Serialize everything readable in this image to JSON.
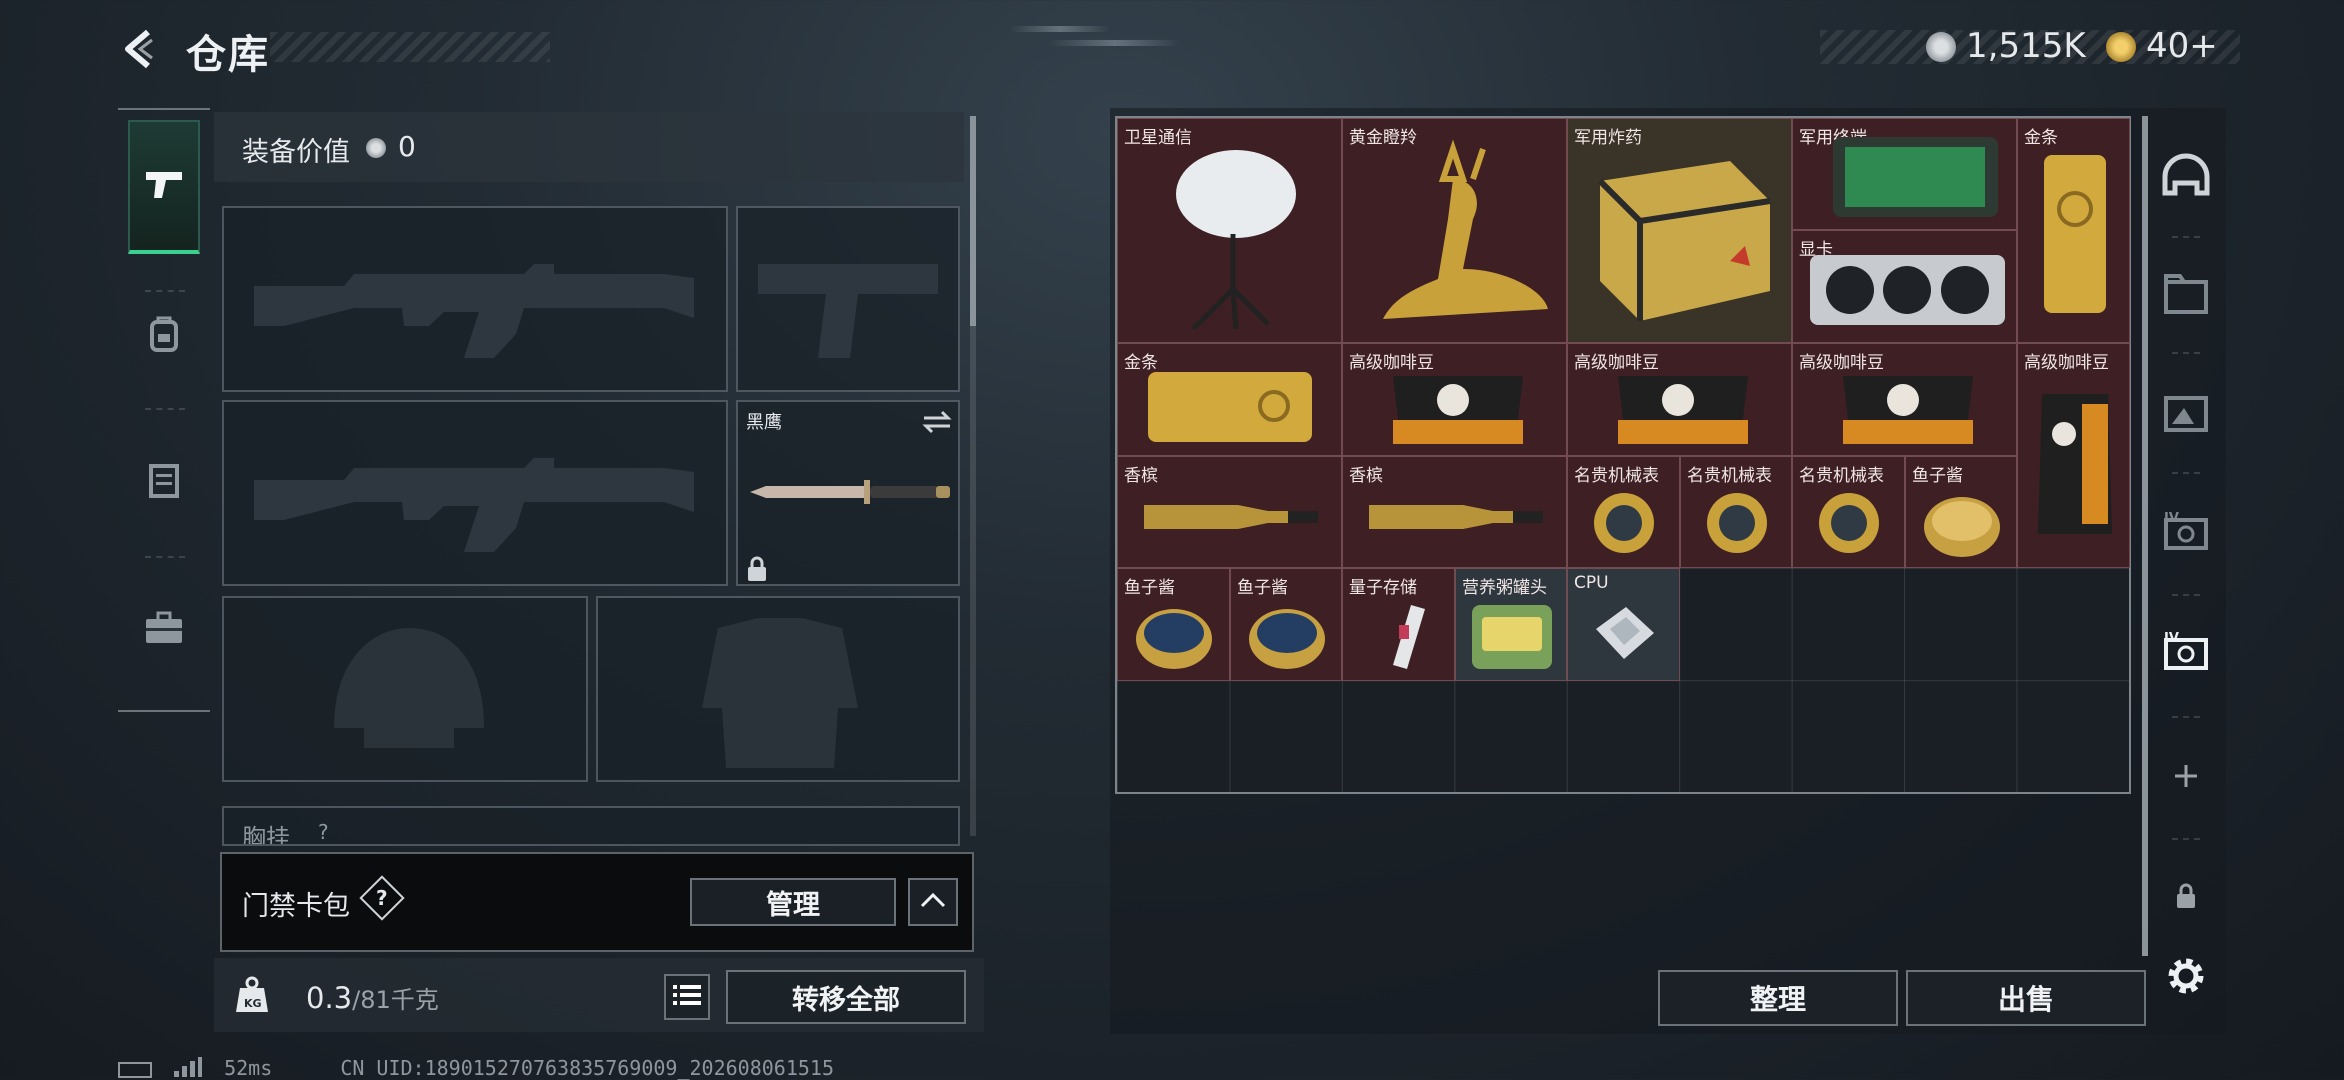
{
  "header": {
    "title": "仓库",
    "currency": [
      {
        "icon": "silver-coin-icon",
        "value": "1,515K"
      },
      {
        "icon": "gold-coin-icon",
        "value": "40+"
      }
    ]
  },
  "left_rail": [
    "pistol-icon",
    "backpack-icon",
    "vest-icon",
    "briefcase-icon"
  ],
  "loadout": {
    "value_label": "装备价值",
    "value": "0",
    "melee_name": "黑鹰",
    "next_label": "胸挂",
    "next_hint": "?"
  },
  "cardpack": {
    "label": "门禁卡包",
    "help": "?",
    "manage": "管理"
  },
  "weight": {
    "current": "0.3",
    "sep": "/",
    "max": "81千克"
  },
  "transfer_all": "转移全部",
  "items": [
    {
      "name": "卫星通信",
      "icon": "satellite-dish-icon"
    },
    {
      "name": "黄金瞪羚",
      "icon": "golden-gazelle-icon"
    },
    {
      "name": "军用炸药",
      "icon": "explosive-crate-icon"
    },
    {
      "name": "军用终端",
      "icon": "military-terminal-icon"
    },
    {
      "name": "金条",
      "icon": "gold-bar-icon"
    },
    {
      "name": "显卡",
      "icon": "graphics-card-icon"
    },
    {
      "name": "金条",
      "icon": "gold-bar-icon"
    },
    {
      "name": "高级咖啡豆",
      "icon": "coffee-bag-icon"
    },
    {
      "name": "高级咖啡豆",
      "icon": "coffee-bag-icon"
    },
    {
      "name": "高级咖啡豆",
      "icon": "coffee-bag-icon"
    },
    {
      "name": "高级咖啡豆",
      "icon": "coffee-bag-icon"
    },
    {
      "name": "香槟",
      "icon": "champagne-icon"
    },
    {
      "name": "香槟",
      "icon": "champagne-icon"
    },
    {
      "name": "名贵机械表",
      "icon": "watch-icon"
    },
    {
      "name": "名贵机械表",
      "icon": "watch-icon"
    },
    {
      "name": "名贵机械表",
      "icon": "watch-icon"
    },
    {
      "name": "鱼子酱",
      "icon": "caviar-tin-icon"
    },
    {
      "name": "鱼子酱",
      "icon": "caviar-tin-icon"
    },
    {
      "name": "鱼子酱",
      "icon": "caviar-tin-icon"
    },
    {
      "name": "量子存储",
      "icon": "usb-drive-icon"
    },
    {
      "name": "营养粥罐头",
      "icon": "food-tin-icon"
    },
    {
      "name": "CPU",
      "icon": "cpu-chip-icon"
    }
  ],
  "actions": {
    "sort": "整理",
    "sell": "出售"
  },
  "right_rail": [
    "helmet-icon",
    "folder-icon",
    "photo-icon",
    "iv-bag-icon",
    "iv-bag-active-icon",
    "add-icon",
    "lock-icon",
    "gear-icon"
  ],
  "footer": {
    "ping": "52ms",
    "uid": "CN UID:1890152707638357690​09_202608061515"
  },
  "colors": {
    "item_bg": "#3d1f24",
    "accent_green": "#3bd08f",
    "panel": "#1a1f25"
  }
}
